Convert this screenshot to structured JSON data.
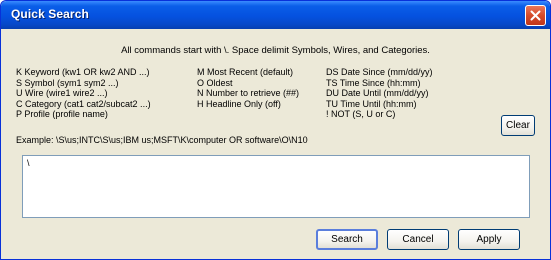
{
  "window": {
    "title": "Quick Search"
  },
  "headline": "All commands start with \\. Space delimit Symbols, Wires, and Categories.",
  "commands": {
    "col1": [
      "K Keyword (kw1 OR kw2 AND ...)",
      "S Symbol (sym1 sym2 ...)",
      "U Wire (wire1 wire2 ...)",
      "C Category (cat1 cat2/subcat2 ...)",
      "P Profile (profile name)"
    ],
    "col2": [
      "M Most Recent (default)",
      "O Oldest",
      "N Number to retrieve (##)",
      "H Headline Only (off)"
    ],
    "col3": [
      "DS Date Since (mm/dd/yy)",
      "TS Time Since (hh:mm)",
      "DU Date Until (mm/dd/yy)",
      "TU Time Until (hh:mm)",
      "!   NOT (S, U or C)"
    ]
  },
  "example": "Example: \\S\\us;INTC\\S\\us;IBM us;MSFT\\K\\computer OR software\\O\\N10",
  "query": {
    "value": "\\"
  },
  "buttons": {
    "clear": "Clear",
    "search": "Search",
    "cancel": "Cancel",
    "apply": "Apply"
  },
  "colors": {
    "titlebar": "#0551df",
    "close": "#d54b2a",
    "dialog_bg": "#ece9d8"
  }
}
